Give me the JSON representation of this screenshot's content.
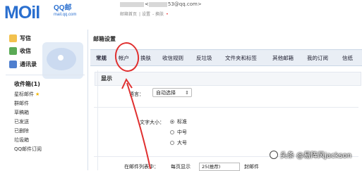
{
  "header": {
    "logo_text": "MOil",
    "logo_brand": "QQ邮",
    "logo_domain": "mail.qq.com",
    "user_email_suffix": "53@qq.com>",
    "user_email_prefix": "<",
    "links": [
      "邮箱首页",
      "设置",
      "换肤"
    ]
  },
  "sidebar": {
    "actions": [
      {
        "label": "写信",
        "icon": "pencil-icon"
      },
      {
        "label": "收信",
        "icon": "inbox-receive-icon"
      },
      {
        "label": "通讯录",
        "icon": "address-book-icon"
      }
    ],
    "folders_title": "收件箱(1)",
    "folders": [
      "星标邮件",
      "群邮件",
      "草稿箱",
      "已发送",
      "已删除",
      "垃圾箱",
      "QQ邮件订阅"
    ]
  },
  "main": {
    "title": "邮箱设置",
    "tabs": [
      "常规",
      "帐户",
      "换肤",
      "收信规则",
      "反垃圾",
      "文件夹和标签",
      "其他邮箱",
      "我的订阅",
      "信纸"
    ],
    "active_tab": "常规",
    "section_title": "显示",
    "language_label": "语言：",
    "language_value": "自动选择",
    "fontsize_label": "文字大小：",
    "fontsize_options": [
      "标准",
      "中号",
      "大号"
    ],
    "fontsize_selected": "标准",
    "bottom_label": "在邮件列表中：",
    "bottom_prefix": "每页显示",
    "bottom_select": "25(推荐)",
    "bottom_suffix": "封邮件"
  },
  "annotation": {
    "color": "#e03030",
    "watermark": "头条 @易阵风jackson"
  }
}
